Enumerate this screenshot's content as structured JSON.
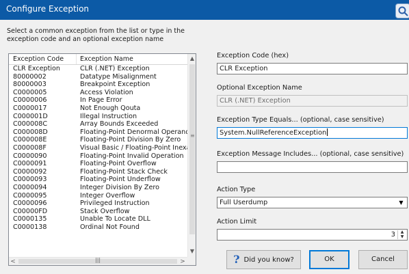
{
  "window": {
    "title": "Configure Exception"
  },
  "instructions": "Select a common exception from the list or type in the exception code and an optional exception name",
  "exception_list": {
    "columns": [
      "Exception Code",
      "Exception Name"
    ],
    "rows": [
      [
        "CLR Exception",
        "CLR (.NET) Exception"
      ],
      [
        "80000002",
        "Datatype Misalignment"
      ],
      [
        "80000003",
        "Breakpoint Exception"
      ],
      [
        "C0000005",
        "Access Violation"
      ],
      [
        "C0000006",
        "In Page Error"
      ],
      [
        "C0000017",
        "Not Enough Qouta"
      ],
      [
        "C000001D",
        "Illegal Instruction"
      ],
      [
        "C000008C",
        "Array Bounds Exceeded"
      ],
      [
        "C000008D",
        "Floating-Point Denormal Operand"
      ],
      [
        "C000008E",
        "Floating-Point Division By Zero"
      ],
      [
        "C000008F",
        "Visual Basic / Floating-Point Inexac"
      ],
      [
        "C0000090",
        "Floating-Point Invalid Operation"
      ],
      [
        "C0000091",
        "Floating-Point Overflow"
      ],
      [
        "C0000092",
        "Floating-Point Stack Check"
      ],
      [
        "C0000093",
        "Floating-Point Underflow"
      ],
      [
        "C0000094",
        "Integer Division By Zero"
      ],
      [
        "C0000095",
        "Integer Overflow"
      ],
      [
        "C0000096",
        "Privileged Instruction"
      ],
      [
        "C00000FD",
        "Stack Overflow"
      ],
      [
        "C0000135",
        "Unable To Locate DLL"
      ],
      [
        "C0000138",
        "Ordinal Not Found"
      ]
    ]
  },
  "form": {
    "code_label": "Exception Code (hex)",
    "code_value": "CLR Exception",
    "name_label": "Optional Exception Name",
    "name_value": "CLR (.NET) Exception",
    "type_label": "Exception Type Equals... (optional, case sensitive)",
    "type_value": "System.NullReferenceException",
    "message_label": "Exception Message Includes... (optional, case sensitive)",
    "message_value": "",
    "action_type_label": "Action Type",
    "action_type_value": "Full Userdump",
    "action_limit_label": "Action Limit",
    "action_limit_value": "3"
  },
  "buttons": {
    "did_you_know": "Did you know?",
    "ok": "OK",
    "cancel": "Cancel"
  },
  "icons": {
    "title_right": "dialog-app-icon",
    "help": "question-mark-icon"
  }
}
